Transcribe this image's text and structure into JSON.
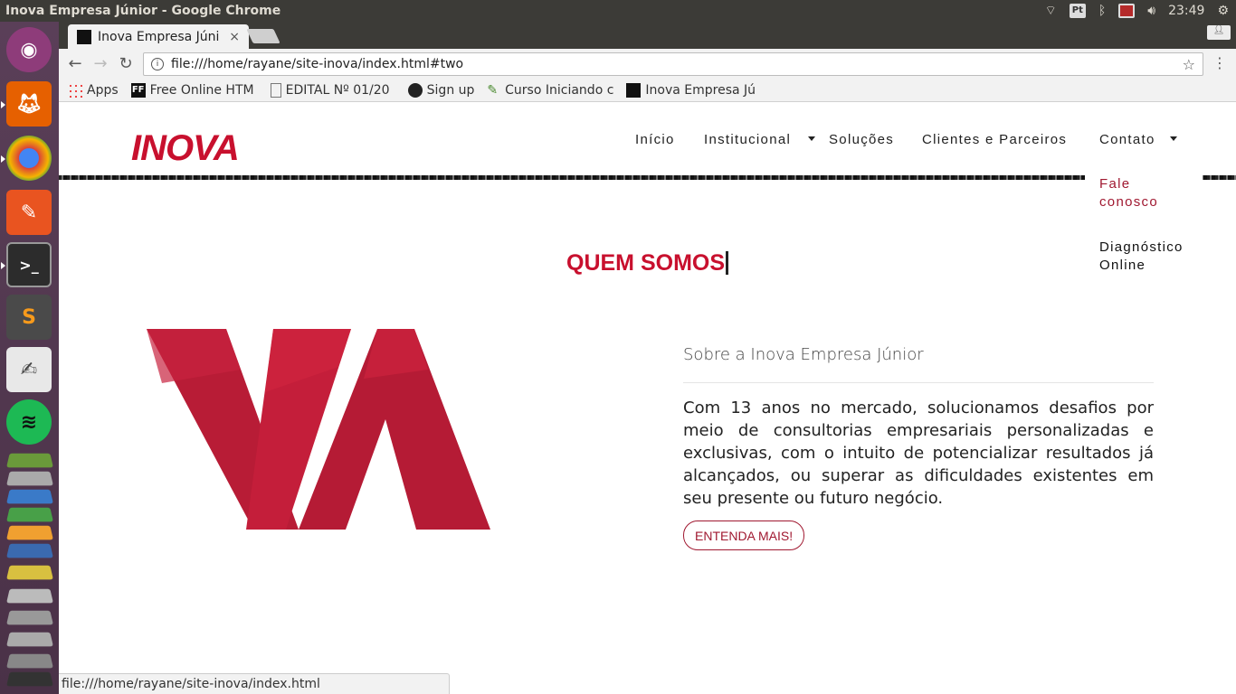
{
  "window": {
    "title": "Inova Empresa Júnior - Google Chrome"
  },
  "tray": {
    "keyboard": "Pt",
    "time": "23:49"
  },
  "chrome": {
    "tab_title": "Inova Empresa Júnior",
    "tab_close": "×",
    "url": "file:///home/rayane/site-inova/index.html#two",
    "status_url": "file:///home/rayane/site-inova/index.html"
  },
  "bookmarks": [
    {
      "label": "Apps",
      "icon": "apps-grid-icon"
    },
    {
      "label": "Free Online HTM",
      "icon": "ff-icon"
    },
    {
      "label": "EDITAL Nº 01/20",
      "icon": "document-icon"
    },
    {
      "label": "Sign up",
      "icon": "github-icon"
    },
    {
      "label": "Curso Iniciando c",
      "icon": "course-icon"
    },
    {
      "label": "Inova Empresa Jú",
      "icon": "inova-favicon"
    }
  ],
  "site": {
    "logo": "INOVA",
    "nav": [
      "Início",
      "Institucional",
      "Soluções",
      "Clientes e Parceiros",
      "Contato"
    ],
    "dropdown": [
      "Fale conosco",
      "Diagnóstico Online"
    ],
    "section_title": "QUEM SOMOS",
    "subtitle": "Sobre a Inova Empresa Júnior",
    "paragraph": "Com 13 anos no mercado, solucionamos desafios por meio de consultorias empresariais personalizadas e exclusivas, com o intuito de potencializar resultados já alcançados, ou superar as dificuldades existentes em seu presente ou futuro negócio.",
    "cta": "ENTENDA MAIS!",
    "brand_color": "#c8102e"
  }
}
